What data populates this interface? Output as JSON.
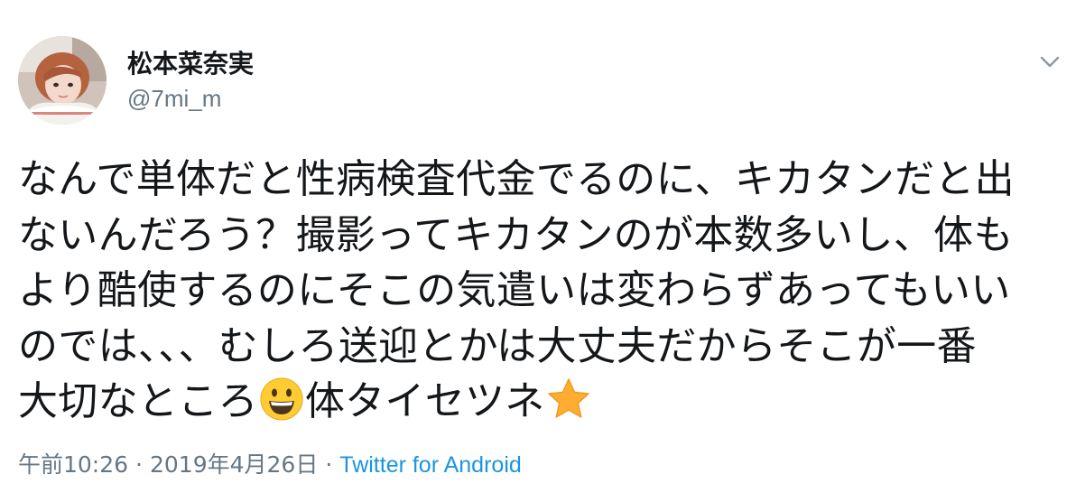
{
  "user": {
    "display_name": "松本菜奈実",
    "handle": "@7mi_m",
    "avatar_icon": "profile-photo"
  },
  "menu": {
    "caret_icon": "chevron-down-icon"
  },
  "tweet": {
    "line1": "なんで単体だと性病検査代金でるのに、キカタンだと出",
    "line2": "ないんだろう？撮影ってキカタンのが本数多いし、体も",
    "line3": "より酷使するのにそこの気遣いは変わらずあってもいい",
    "line4": "のでは、、、むしろ送迎とかは大丈夫だからそこが一番",
    "line5a": "大切なところ",
    "emoji1": "grinning-face-emoji",
    "line5b": "体タイセツネ",
    "emoji2": "star-emoji"
  },
  "meta": {
    "time": "午前10:26",
    "separator": "·",
    "date": "2019年4月26日",
    "source": "Twitter for Android"
  },
  "colors": {
    "text": "#14171a",
    "secondary": "#657786",
    "link": "#1b95e0"
  }
}
